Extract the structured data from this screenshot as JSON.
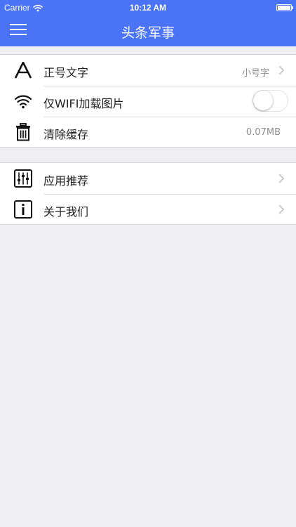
{
  "status_bar": {
    "carrier": "Carrier",
    "time": "10:12 AM"
  },
  "navbar": {
    "title": "头条军事",
    "menu_icon": "hamburger-menu-icon"
  },
  "settings": {
    "group1": [
      {
        "icon": "font-a-icon",
        "label": "正号文字",
        "value": "小号字"
      },
      {
        "icon": "wifi-icon",
        "label": "仅WIFI加载图片",
        "toggle_on": false
      },
      {
        "icon": "trash-icon",
        "label": "清除缓存",
        "value": "0.07MB"
      }
    ],
    "group2": [
      {
        "icon": "sliders-icon",
        "label": "应用推荐"
      },
      {
        "icon": "info-icon",
        "label": "关于我们"
      }
    ]
  },
  "colors": {
    "accent": "#4a74f5",
    "background": "#efeff4"
  }
}
